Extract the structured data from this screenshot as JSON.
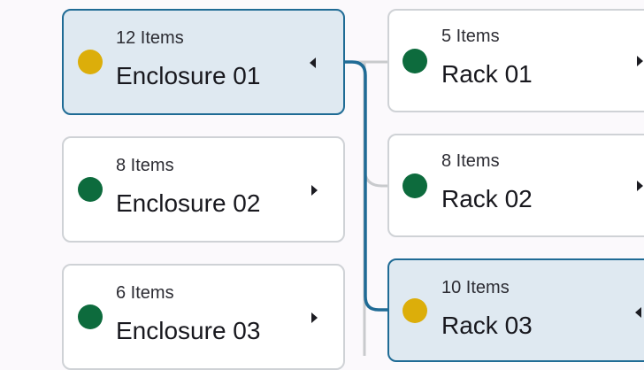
{
  "colors": {
    "status_yellow": "#dcae0a",
    "status_green": "#0d6b3d",
    "selected_accent": "#1f6b95",
    "connector_gray": "#c8cacd"
  },
  "enclosures": [
    {
      "count": "12 Items",
      "name": "Enclosure 01",
      "status": "yellow",
      "expanded": true,
      "arrow_icon": "triangle-left-icon"
    },
    {
      "count": "8 Items",
      "name": "Enclosure 02",
      "status": "green",
      "expanded": false,
      "arrow_icon": "triangle-right-icon"
    },
    {
      "count": "6 Items",
      "name": "Enclosure 03",
      "status": "green",
      "expanded": false,
      "arrow_icon": "triangle-right-icon"
    }
  ],
  "racks": [
    {
      "count": "5 Items",
      "name": "Rack 01",
      "status": "green",
      "expanded": false,
      "arrow_icon": "triangle-right-icon"
    },
    {
      "count": "8 Items",
      "name": "Rack 02",
      "status": "green",
      "expanded": false,
      "arrow_icon": "triangle-right-icon"
    },
    {
      "count": "10 Items",
      "name": "Rack 03",
      "status": "yellow",
      "expanded": true,
      "arrow_icon": "triangle-left-icon"
    }
  ]
}
